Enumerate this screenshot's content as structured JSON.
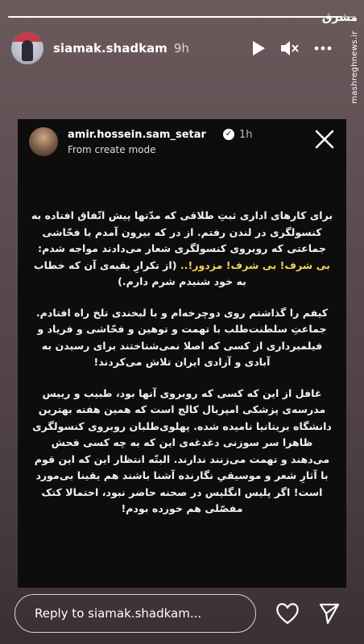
{
  "story": {
    "progress": 0.96,
    "username": "siamak.shadkam",
    "time": "9h",
    "icons": [
      "play-icon",
      "mute-icon",
      "more-icon"
    ]
  },
  "watermark": {
    "logo": "مشرق",
    "site": "mashreghnews.ir"
  },
  "card": {
    "username": "amir.hossein.sam_setar",
    "time": "1h",
    "subtitle": "From create mode",
    "paragraphs": [
      {
        "before": "برای کارهای اداری ثبتِ طلاقی که مدّتها پیش اتّفاق افتاده به کنسولگری در لندن رفتم. از در که بیرون آمدم با فحّاشی جماعتی که روبروی کنسولگری شعار می‌دادند مواجه شدم: ",
        "highlight": "بی شرف! بی شرف! مزدور!..",
        "after": " (از تکرارِ بقیه‌ی آن که خطاب به خود شنیدم شرم دارم.)"
      },
      {
        "before": "کیفم را گذاشتم روی دوچرخه‌ام و با لبخندی تلخ راه افتادم. جماعتِ سلطنت‌طلب با تهمت و توهین و فحّاشی و فریاد و فیلمبرداری از کسی که اصلا نمی‌شناختند برای رسیدن به آبادی و آزادی ایران تلاش می‌کردند!",
        "highlight": "",
        "after": ""
      },
      {
        "before": "غافل از این که کسی که روبروی آنها بود، طبیب و رییس مدرسه‌ی پزشکی امپریال کالج است که همین هفته بهترین دانشگاه بریتانیا نامیده شده. پهلوی‌طلبان روبروی کنسولگری ظاهرا سر سوزنی دغدغه‌ی این که به چه کسی فحش می‌دهند و تهمت می‌زنند ندارند. البتّه انتظار این که این قوم با آثارِ شعر و موسیقیِ نگارنده آشنا باشند هم یقینا بی‌مورد است! اگر پلیس انگلیس در صحنه حاضر نبود، احتمالا کتک مفصّلی هم خورده بودم!",
        "highlight": "",
        "after": ""
      }
    ]
  },
  "reply": {
    "placeholder": "Reply to siamak.shadkam..."
  }
}
